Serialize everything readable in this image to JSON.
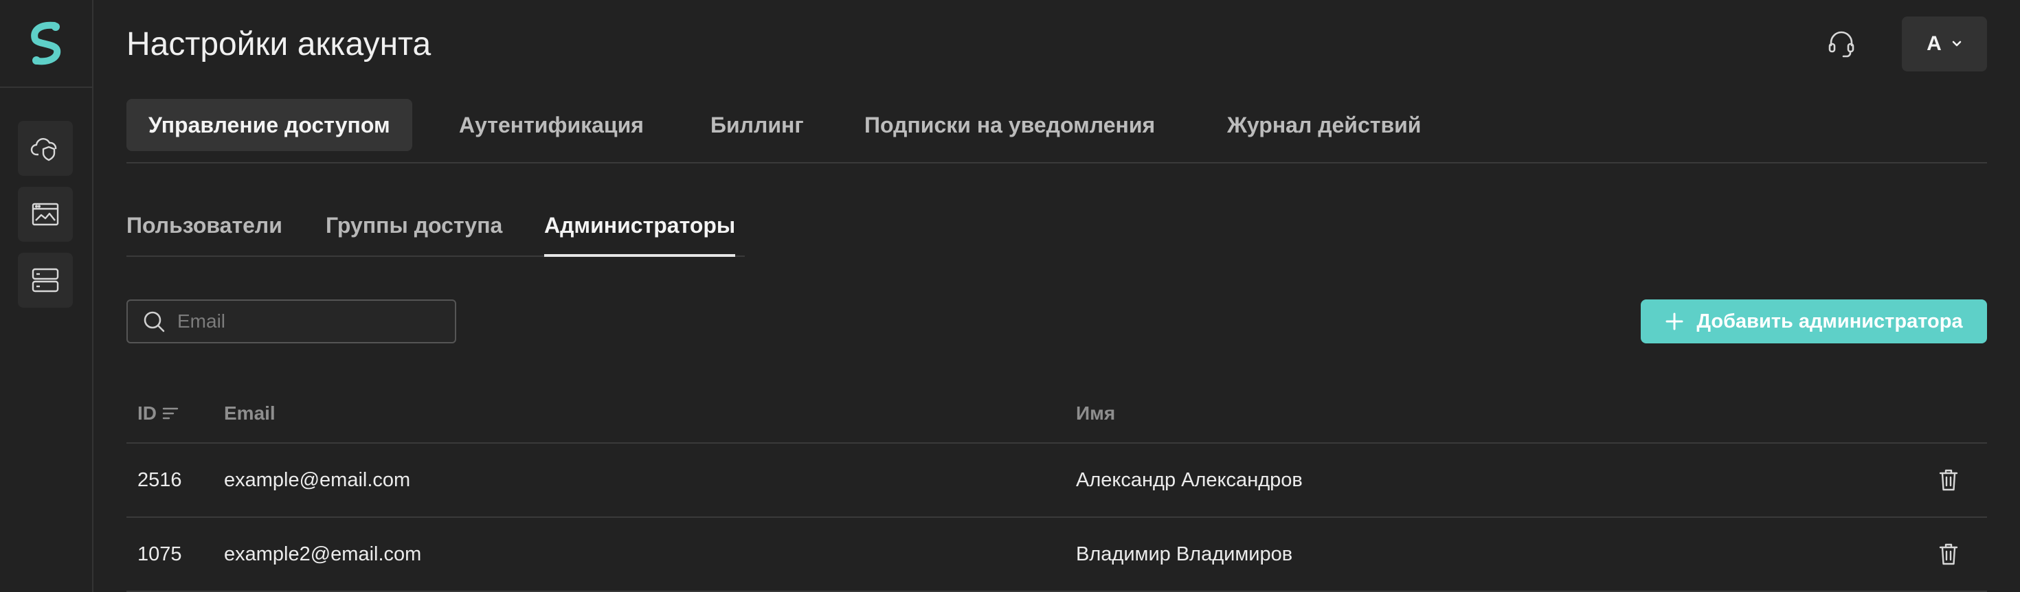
{
  "header": {
    "title": "Настройки аккаунта",
    "account_initial": "A"
  },
  "top_tabs": [
    {
      "label": "Управление доступом",
      "active": true
    },
    {
      "label": "Аутентификация",
      "active": false
    },
    {
      "label": "Биллинг",
      "active": false
    },
    {
      "label": "Подписки на уведомления",
      "active": false
    },
    {
      "label": "Журнал действий",
      "active": false
    }
  ],
  "sub_tabs": [
    {
      "label": "Пользователи",
      "active": false
    },
    {
      "label": "Группы доступа",
      "active": false
    },
    {
      "label": "Администраторы",
      "active": true
    }
  ],
  "search": {
    "placeholder": "Email",
    "value": ""
  },
  "add_button": {
    "label": "Добавить администратора"
  },
  "table": {
    "columns": {
      "id": "ID",
      "email": "Email",
      "name": "Имя"
    },
    "rows": [
      {
        "id": "2516",
        "email": "example@email.com",
        "name": "Александр Александров"
      },
      {
        "id": "1075",
        "email": "example2@email.com",
        "name": "Владимир Владимиров"
      }
    ]
  },
  "sidebar": {
    "icons": [
      "cloud-shield-icon",
      "image-browser-icon",
      "server-icon"
    ]
  },
  "colors": {
    "accent": "#5ed0c8",
    "background": "#222222"
  }
}
